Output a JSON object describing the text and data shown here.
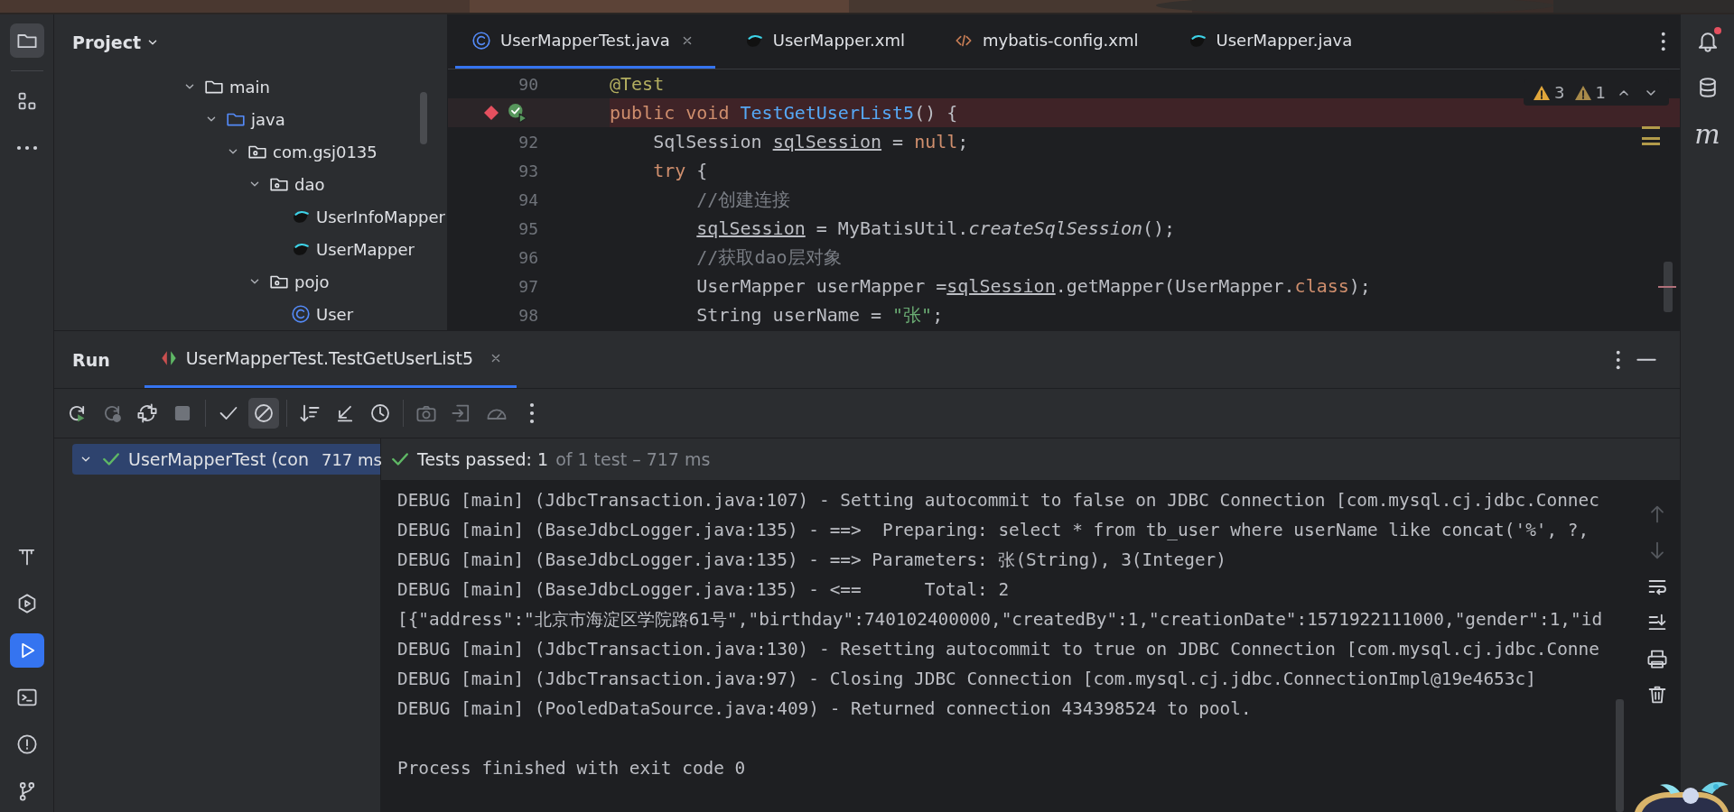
{
  "left_toolbar": {
    "top": [
      {
        "kind": "project",
        "selected": true
      },
      {
        "kind": "structure",
        "selected": false
      },
      {
        "kind": "more",
        "selected": false
      }
    ],
    "bottom": [
      {
        "kind": "build",
        "selected": false
      },
      {
        "kind": "services",
        "selected": false
      },
      {
        "kind": "run",
        "selected": true
      },
      {
        "kind": "terminal",
        "selected": false
      },
      {
        "kind": "problems",
        "selected": false
      },
      {
        "kind": "git",
        "selected": false
      }
    ]
  },
  "project_panel": {
    "title": "Project",
    "tree": [
      {
        "label": "main",
        "kind": "folder",
        "expanded": true,
        "children": [
          {
            "label": "java",
            "kind": "source-folder",
            "expanded": true,
            "children": [
              {
                "label": "com.gsj0135",
                "kind": "package",
                "expanded": true,
                "children": [
                  {
                    "label": "dao",
                    "kind": "package",
                    "expanded": true,
                    "children": [
                      {
                        "label": "UserInfoMapper",
                        "kind": "mapper"
                      },
                      {
                        "label": "UserMapper",
                        "kind": "mapper"
                      }
                    ]
                  },
                  {
                    "label": "pojo",
                    "kind": "package",
                    "expanded": true,
                    "children": [
                      {
                        "label": "User",
                        "kind": "class"
                      }
                    ]
                  }
                ]
              }
            ]
          }
        ]
      }
    ]
  },
  "editor": {
    "tabs": [
      {
        "label": "UserMapperTest.java",
        "kind": "class",
        "selected": true,
        "closable": true
      },
      {
        "label": "UserMapper.xml",
        "kind": "mapper",
        "selected": false,
        "closable": false
      },
      {
        "label": "mybatis-config.xml",
        "kind": "xml",
        "selected": false,
        "closable": false
      },
      {
        "label": "UserMapper.java",
        "kind": "mapper",
        "selected": false,
        "closable": false
      }
    ],
    "inspections": [
      {
        "kind": "warning",
        "count": "3"
      },
      {
        "kind": "weak-warning",
        "count": "1"
      }
    ],
    "lines": [
      {
        "number": "90",
        "highlighted": false,
        "breakpoint": false,
        "run_marker": false,
        "tokens": [
          {
            "text": "@Test",
            "kind": "annotation"
          }
        ]
      },
      {
        "highlighted": true,
        "breakpoint": true,
        "run_marker": true,
        "tokens": [
          {
            "text": "public void ",
            "kind": "keyword"
          },
          {
            "text": "TestGetUserList5",
            "kind": "method"
          },
          {
            "text": "() {",
            "kind": "plain"
          }
        ]
      },
      {
        "number": "92",
        "highlighted": false,
        "breakpoint": false,
        "run_marker": false,
        "tokens": [
          {
            "text": "    SqlSession ",
            "kind": "plain"
          },
          {
            "text": "sqlSession",
            "kind": "reassigned"
          },
          {
            "text": " = ",
            "kind": "plain"
          },
          {
            "text": "null",
            "kind": "keyword"
          },
          {
            "text": ";",
            "kind": "plain"
          }
        ]
      },
      {
        "number": "93",
        "highlighted": false,
        "breakpoint": false,
        "run_marker": false,
        "tokens": [
          {
            "text": "    try",
            "kind": "keyword"
          },
          {
            "text": " {",
            "kind": "plain"
          }
        ]
      },
      {
        "number": "94",
        "highlighted": false,
        "breakpoint": false,
        "run_marker": false,
        "tokens": [
          {
            "text": "        //创建连接",
            "kind": "comment"
          }
        ]
      },
      {
        "number": "95",
        "highlighted": false,
        "breakpoint": false,
        "run_marker": false,
        "tokens": [
          {
            "text": "        sqlSession",
            "kind": "reassigned"
          },
          {
            "text": " = MyBatisUtil.",
            "kind": "plain"
          },
          {
            "text": "createSqlSession",
            "kind": "static"
          },
          {
            "text": "();",
            "kind": "plain"
          }
        ]
      },
      {
        "number": "96",
        "highlighted": false,
        "breakpoint": false,
        "run_marker": false,
        "tokens": [
          {
            "text": "        //获取dao层对象",
            "kind": "comment"
          }
        ]
      },
      {
        "number": "97",
        "highlighted": false,
        "breakpoint": false,
        "run_marker": false,
        "tokens": [
          {
            "text": "        UserMapper userMapper =",
            "kind": "plain"
          },
          {
            "text": "sqlSession",
            "kind": "reassigned"
          },
          {
            "text": ".getMapper(UserMapper.",
            "kind": "plain"
          },
          {
            "text": "class",
            "kind": "keyword"
          },
          {
            "text": ");",
            "kind": "plain"
          }
        ]
      },
      {
        "number": "98",
        "highlighted": false,
        "breakpoint": false,
        "run_marker": false,
        "tokens": [
          {
            "text": "        String userName = ",
            "kind": "plain"
          },
          {
            "text": "\"张\"",
            "kind": "string"
          },
          {
            "text": ";",
            "kind": "plain"
          }
        ]
      }
    ]
  },
  "right_toolbar": [
    {
      "kind": "notifications",
      "badge": true
    },
    {
      "kind": "database",
      "badge": false
    },
    {
      "kind": "maven",
      "badge": false,
      "glyph": "m"
    }
  ],
  "run_panel": {
    "title": "Run",
    "tabs": [
      {
        "label": "UserMapperTest.TestGetUserList5",
        "selected": true,
        "closable": true
      }
    ],
    "toolbar": [
      [
        {
          "kind": "rerun",
          "disabled": false,
          "on": false
        },
        {
          "kind": "rerun-failed",
          "disabled": true,
          "on": false
        },
        {
          "kind": "toggle-auto",
          "disabled": false,
          "on": false
        },
        {
          "kind": "stop",
          "disabled": true,
          "on": false
        }
      ],
      [
        {
          "kind": "show-passed",
          "disabled": false,
          "on": false
        },
        {
          "kind": "show-ignored",
          "disabled": false,
          "on": true
        }
      ],
      [
        {
          "kind": "sort",
          "disabled": false,
          "on": false
        },
        {
          "kind": "collapse",
          "disabled": false,
          "on": false
        },
        {
          "kind": "history",
          "disabled": false,
          "on": false
        }
      ],
      [
        {
          "kind": "screenshot",
          "disabled": true,
          "on": false
        },
        {
          "kind": "import",
          "disabled": true,
          "on": false
        },
        {
          "kind": "coverage",
          "disabled": true,
          "on": false
        },
        {
          "kind": "overflow",
          "disabled": false,
          "on": false
        }
      ]
    ],
    "tests": [
      {
        "label": "UserMapperTest (con",
        "time": "717 ms",
        "passed": true,
        "selected": true,
        "expanded": true
      }
    ],
    "summary": {
      "passed": true,
      "result": "Tests passed: 1",
      "detail": "of 1 test – 717 ms"
    },
    "console": [
      {
        "kind": "log",
        "text": "DEBUG [main] (JdbcTransaction.java:107) - Setting autocommit to false on JDBC Connection [com.mysql.cj.jdbc.Connec"
      },
      {
        "kind": "log",
        "text": "DEBUG [main] (BaseJdbcLogger.java:135) - ==>  Preparing: select * from tb_user where userName like concat('%', ?,"
      },
      {
        "kind": "log",
        "text": "DEBUG [main] (BaseJdbcLogger.java:135) - ==> Parameters: 张(String), 3(Integer)"
      },
      {
        "kind": "log",
        "text": "DEBUG [main] (BaseJdbcLogger.java:135) - <==      Total: 2"
      },
      {
        "kind": "log",
        "text": "[{\"address\":\"北京市海淀区学院路61号\",\"birthday\":740102400000,\"createdBy\":1,\"creationDate\":1571922111000,\"gender\":1,\"id"
      },
      {
        "kind": "log",
        "text": "DEBUG [main] (JdbcTransaction.java:130) - Resetting autocommit to true on JDBC Connection [com.mysql.cj.jdbc.Conne"
      },
      {
        "kind": "log",
        "text": "DEBUG [main] (JdbcTransaction.java:97) - Closing JDBC Connection [com.mysql.cj.jdbc.ConnectionImpl@19e4653c]"
      },
      {
        "kind": "log",
        "text": "DEBUG [main] (PooledDataSource.java:409) - Returned connection 434398524 to pool."
      },
      {
        "kind": "exit",
        "text": "Process finished with exit code 0"
      }
    ],
    "console_tools": [
      {
        "kind": "up",
        "disabled": true
      },
      {
        "kind": "down",
        "disabled": true
      },
      {
        "kind": "wrap",
        "disabled": false
      },
      {
        "kind": "scroll-end",
        "disabled": false
      },
      {
        "kind": "print",
        "disabled": false
      },
      {
        "kind": "clear",
        "disabled": false
      }
    ]
  }
}
